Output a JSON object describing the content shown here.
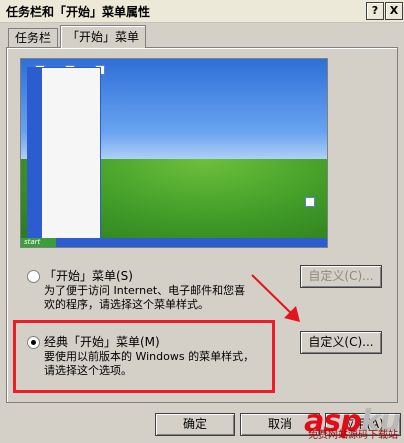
{
  "window": {
    "title": "任务栏和「开始」菜单属性",
    "help_btn": "?",
    "close_btn": "X"
  },
  "tabs": [
    {
      "label": "任务栏"
    },
    {
      "label": "「开始」菜单"
    }
  ],
  "preview": {
    "start_label": "start"
  },
  "options": {
    "startmenu": {
      "label": "「开始」菜单(S)",
      "desc": "为了便于访问 Internet、电子邮件和您喜\n欢的程序，请选择这个菜单样式。",
      "customize": "自定义(C)..."
    },
    "classic": {
      "label": "经典「开始」菜单(M)",
      "desc": "要使用以前版本的 Windows 的菜单样式，\n请选择这个选项。",
      "customize": "自定义(C)..."
    }
  },
  "footer": {
    "ok": "确定",
    "cancel": "取消",
    "apply": "应用(A)"
  },
  "watermark": {
    "brand": "aspku",
    "brand_a": "asp",
    "brand_b": "ku",
    "sub": "免费网站源码下载站"
  },
  "colors": {
    "highlight": "#ee1c24",
    "arrow": "#e3141c"
  }
}
